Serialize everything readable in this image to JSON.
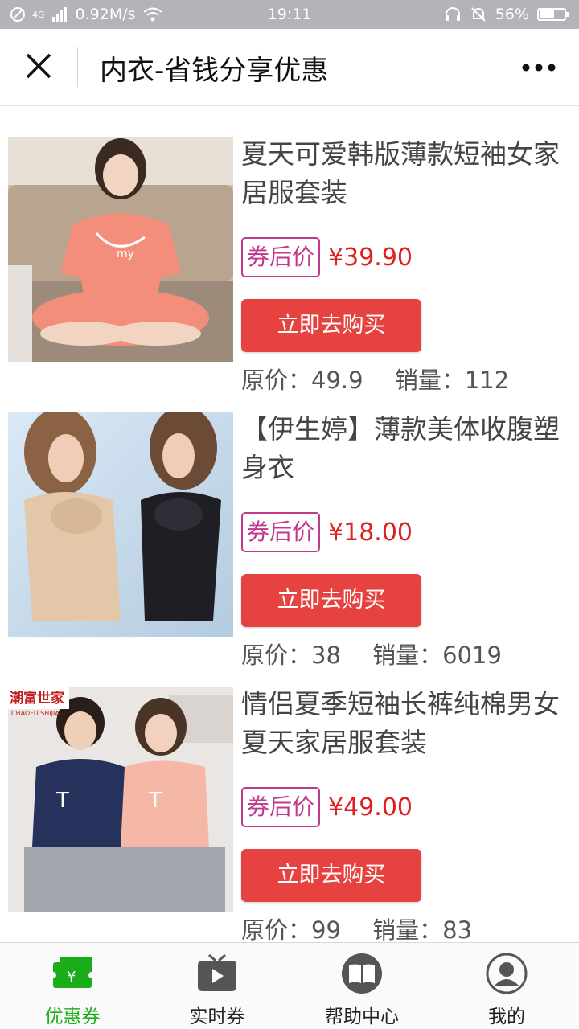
{
  "status_bar": {
    "network_type": "4G",
    "speed": "0.92M/s",
    "time": "19:11",
    "battery": "56%"
  },
  "nav": {
    "title": "内衣-省钱分享优惠"
  },
  "products": [
    {
      "title": "夏天可爱韩版薄款短袖女家居服套装",
      "coupon_label": "券后价",
      "price": "¥39.90",
      "buy_label": "立即去购买",
      "orig_label": "原价：",
      "orig_price": "49.9",
      "sales_label": "销量：",
      "sales": "112"
    },
    {
      "title": "【伊生婷】薄款美体收腹塑身衣",
      "coupon_label": "券后价",
      "price": "¥18.00",
      "buy_label": "立即去购买",
      "orig_label": "原价：",
      "orig_price": "38",
      "sales_label": "销量：",
      "sales": "6019"
    },
    {
      "title": "情侣夏季短袖长裤纯棉男女夏天家居服套装",
      "coupon_label": "券后价",
      "price": "¥49.00",
      "buy_label": "立即去购买",
      "orig_label": "原价：",
      "orig_price": "99",
      "sales_label": "销量：",
      "sales": "83"
    }
  ],
  "thumb3_brand": {
    "cn": "潮富世家",
    "en": "CHAOFU SHIJIA"
  },
  "tabs": [
    {
      "label": "优惠券",
      "icon": "coupon-icon",
      "active": true
    },
    {
      "label": "实时券",
      "icon": "tv-play-icon",
      "active": false
    },
    {
      "label": "帮助中心",
      "icon": "book-icon",
      "active": false
    },
    {
      "label": "我的",
      "icon": "user-icon",
      "active": false
    }
  ],
  "colors": {
    "accent_green": "#1aad19",
    "buy_button": "#e64340",
    "price_red": "#e02020",
    "coupon_tag": "#c0398a"
  }
}
